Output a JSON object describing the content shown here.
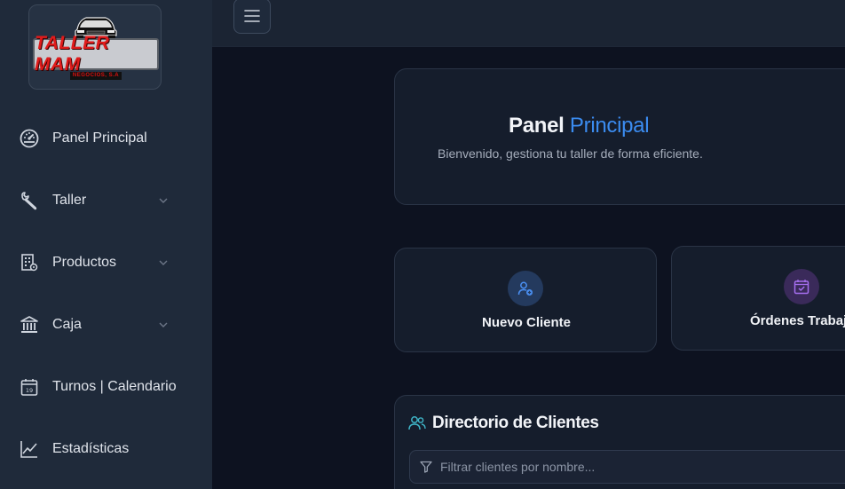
{
  "logo": {
    "brand_text": "TALLER MAM",
    "sub_text": "NEGOCIOS, S.A"
  },
  "sidebar": {
    "items": [
      {
        "label": "Panel Principal",
        "icon": "gauge-icon",
        "has_chevron": false
      },
      {
        "label": "Taller",
        "icon": "wrench-icon",
        "has_chevron": true
      },
      {
        "label": "Productos",
        "icon": "inventory-icon",
        "has_chevron": true
      },
      {
        "label": "Caja",
        "icon": "bank-icon",
        "has_chevron": true
      },
      {
        "label": "Turnos | Calendario",
        "icon": "calendar-icon",
        "has_chevron": false
      },
      {
        "label": "Estadísticas",
        "icon": "chart-line-icon",
        "has_chevron": false
      }
    ]
  },
  "topbar": {
    "menu_icon": "hamburger-icon"
  },
  "hero": {
    "title_part1": "Panel",
    "title_part2": "Principal",
    "subtitle": "Bienvenido, gestiona tu taller de forma eficiente."
  },
  "actions": [
    {
      "label": "Nuevo Cliente",
      "icon": "user-plus-icon",
      "accent": "#4a8ff2"
    },
    {
      "label": "Órdenes Trabaj",
      "icon": "calendar-check-icon",
      "accent": "#a66ff0"
    }
  ],
  "directory": {
    "title": "Directorio de Clientes",
    "icon": "users-icon",
    "filter_placeholder": "Filtrar clientes por nombre..."
  },
  "colors": {
    "sidebar_bg": "#1f2a3a",
    "main_bg": "#0d1220",
    "card_bg": "#151d2c",
    "accent_blue": "#3b8cf0",
    "accent_teal": "#3fb6c9"
  }
}
